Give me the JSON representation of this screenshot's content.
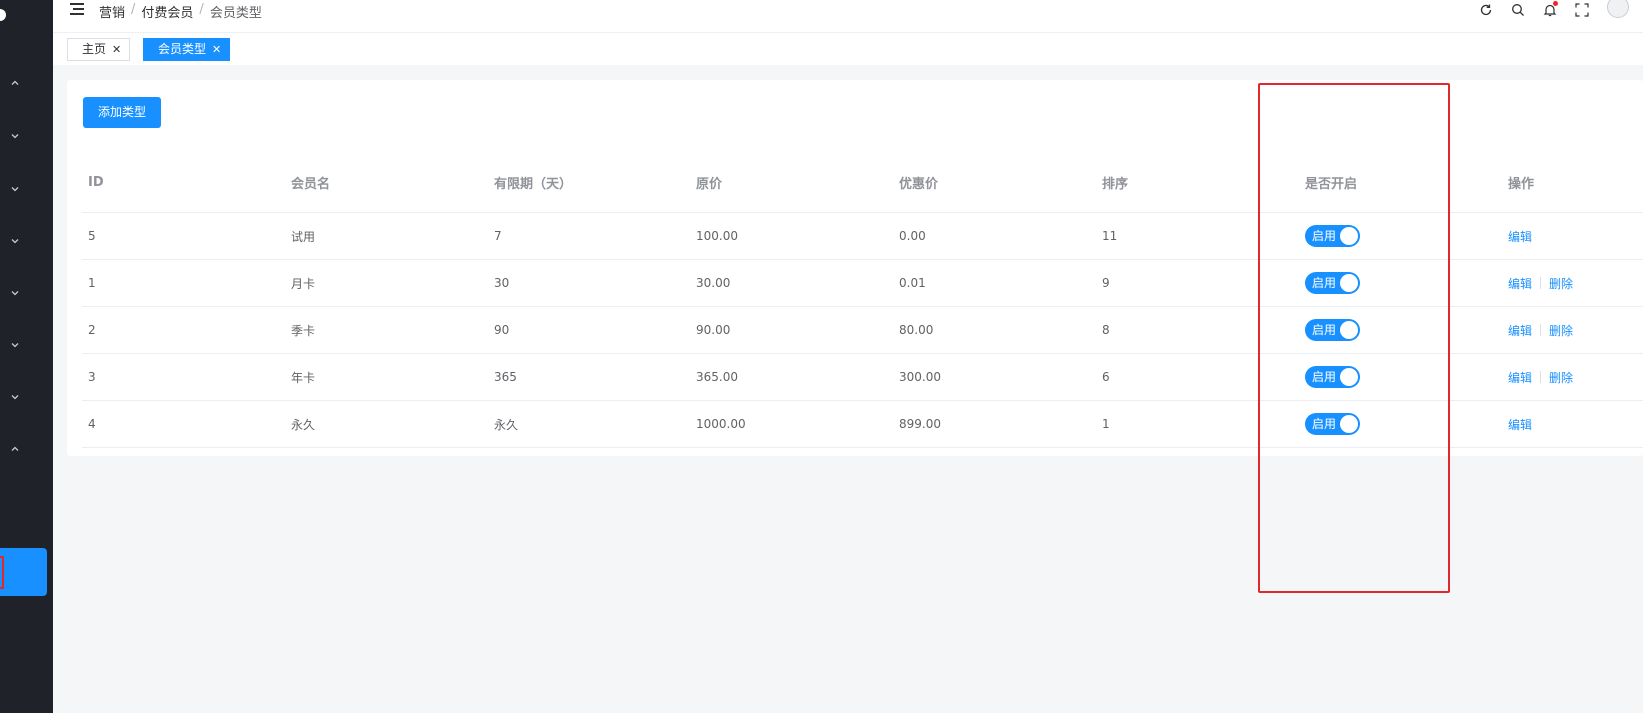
{
  "breadcrumb": [
    "营销",
    "付费会员",
    "会员类型"
  ],
  "tabs": [
    {
      "label": "主页",
      "active": false
    },
    {
      "label": "会员类型",
      "active": true
    }
  ],
  "toolbar": {
    "add_label": "添加类型"
  },
  "table": {
    "headers": [
      "ID",
      "会员名",
      "有限期（天）",
      "原价",
      "优惠价",
      "排序",
      "是否开启",
      "操作"
    ],
    "rows": [
      {
        "id": "5",
        "name": "试用",
        "days": "7",
        "price": "100.00",
        "discount": "0.00",
        "sort": "11",
        "status": "启用",
        "enabled": true,
        "actions": [
          "编辑"
        ]
      },
      {
        "id": "1",
        "name": "月卡",
        "days": "30",
        "price": "30.00",
        "discount": "0.01",
        "sort": "9",
        "status": "启用",
        "enabled": true,
        "actions": [
          "编辑",
          "删除"
        ]
      },
      {
        "id": "2",
        "name": "季卡",
        "days": "90",
        "price": "90.00",
        "discount": "80.00",
        "sort": "8",
        "status": "启用",
        "enabled": true,
        "actions": [
          "编辑",
          "删除"
        ]
      },
      {
        "id": "3",
        "name": "年卡",
        "days": "365",
        "price": "365.00",
        "discount": "300.00",
        "sort": "6",
        "status": "启用",
        "enabled": true,
        "actions": [
          "编辑",
          "删除"
        ]
      },
      {
        "id": "4",
        "name": "永久",
        "days": "永久",
        "price": "1000.00",
        "discount": "899.00",
        "sort": "1",
        "status": "启用",
        "enabled": true,
        "actions": [
          "编辑"
        ]
      }
    ]
  },
  "icons": {
    "header": [
      "menu-icon",
      "refresh-icon",
      "search-icon",
      "bell-icon",
      "fullscreen-icon"
    ],
    "sidebar": [
      "chevron-up-icon",
      "chevron-down-icon",
      "chevron-down-icon",
      "chevron-down-icon",
      "chevron-down-icon",
      "chevron-down-icon",
      "chevron-down-icon",
      "chevron-up-icon"
    ]
  },
  "colors": {
    "accent": "#1890ff",
    "sidebar": "#1f2229",
    "highlight": "#e0292b",
    "notification": "#f5222d"
  }
}
